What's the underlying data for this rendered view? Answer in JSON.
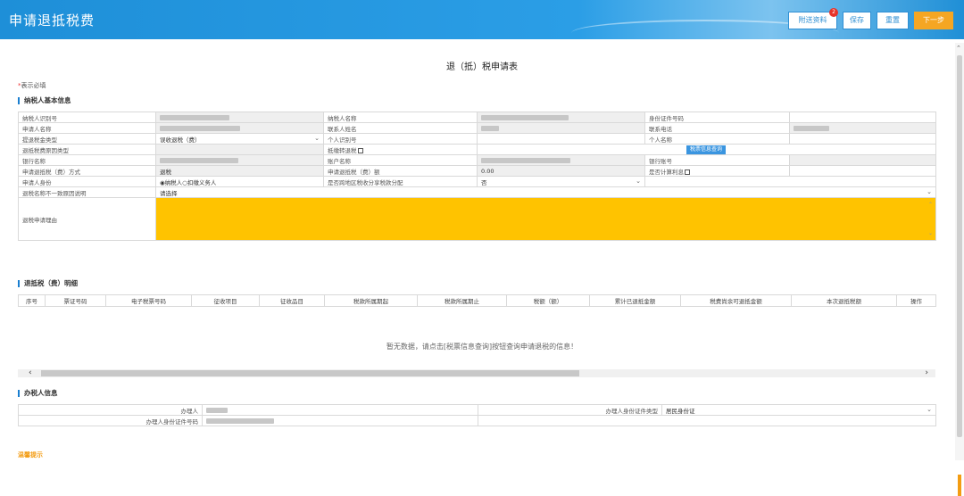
{
  "header": {
    "title": "申请退抵税费",
    "buttons": {
      "send_material": "附送资料",
      "save": "保存",
      "reset": "重置",
      "next": "下一步"
    },
    "badge_count": "2"
  },
  "form_title": "退（抵）税申请表",
  "required_note": {
    "star": "*",
    "text": "表示必填"
  },
  "sections": {
    "taxpayer_info": "纳税人基本信息",
    "detail": "退抵税（费）明细",
    "agent_info": "办税人信息",
    "warm_tip": "温馨提示"
  },
  "taxpayer": {
    "r1": {
      "l1": "纳税人识别号",
      "l2": "纳税人名称",
      "l3": "身份证件号码"
    },
    "r2": {
      "l1": "申请人名称",
      "l2": "联系人姓名",
      "l3": "联系电话"
    },
    "r3": {
      "l1": "提退税金类型",
      "v1": "误收退税（费）",
      "l2": "个人识别号",
      "l3": "个人名称"
    },
    "r4": {
      "l1": "退抵税费原因类型",
      "l2": "抵缴转退税",
      "btn": "税票信息查询"
    },
    "r5": {
      "l1": "银行名称",
      "l2": "账户名称",
      "l3": "银行账号"
    },
    "r6": {
      "l1": "申请退抵税（费）方式",
      "v1": "退税",
      "l2": "申请退抵税（费）额",
      "v2": "0.00",
      "l3": "是否计算利息"
    },
    "r7": {
      "l1": "申请人身份",
      "v1a": "◉纳税人",
      "v1b": "○扣缴义务人",
      "l2": "是否跨地区税收分享税款分配",
      "v2": "否"
    },
    "r8": {
      "l1": "退税名称不一致原因说明",
      "v1": "请选择"
    },
    "r9": {
      "l1": "退税申请理由"
    }
  },
  "detail_table": {
    "headers": [
      "序号",
      "票证号码",
      "电子税票号码",
      "征收项目",
      "征收品目",
      "税款所属期起",
      "税款所属期止",
      "税额（额）",
      "累计已退抵金额",
      "税费尚余可退抵金额",
      "本次退抵税额",
      "操作"
    ],
    "empty_text": "暂无数据，请点击[税票信息查询]按钮查询申请退税的信息！"
  },
  "agent": {
    "l1": "办理人",
    "l2": "办理人身份证件类型",
    "v2": "居民身份证",
    "l3": "办理人身份证件号码"
  }
}
